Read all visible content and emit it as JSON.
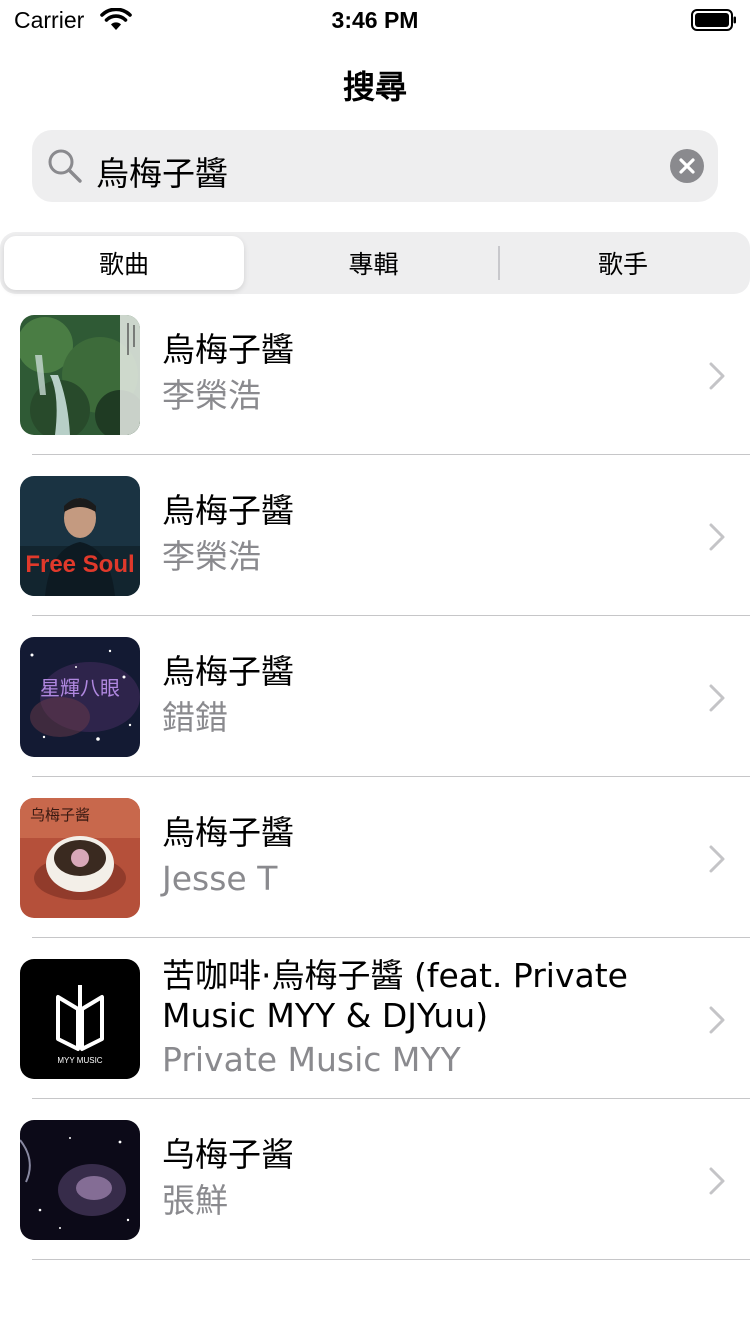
{
  "status_bar": {
    "carrier": "Carrier",
    "time": "3:46 PM"
  },
  "nav": {
    "title": "搜尋"
  },
  "search": {
    "query": "烏梅子醬"
  },
  "segments": [
    {
      "label": "歌曲",
      "selected": true
    },
    {
      "label": "專輯",
      "selected": false
    },
    {
      "label": "歌手",
      "selected": false
    }
  ],
  "results": [
    {
      "title": "烏梅子醬",
      "title_line2": "",
      "artist": "李榮浩",
      "artwork_text": ""
    },
    {
      "title": "烏梅子醬",
      "title_line2": "",
      "artist": "李榮浩",
      "artwork_text": "Free Soul"
    },
    {
      "title": "烏梅子醬",
      "title_line2": "",
      "artist": "錯錯",
      "artwork_text": "星輝八眼"
    },
    {
      "title": "烏梅子醬",
      "title_line2": "",
      "artist": "Jesse T",
      "artwork_text": "乌梅子酱"
    },
    {
      "title": "苦咖啡·烏梅子醬 (feat. Private",
      "title_line2": "Music MYY & DJYuu)",
      "artist": "Private Music MYY",
      "artwork_text": "MYY MUSIC"
    },
    {
      "title": "乌梅子酱",
      "title_line2": "",
      "artist": "張鮮",
      "artwork_text": ""
    }
  ],
  "colors": {
    "secondary_text": "#8a8a8e",
    "search_bg": "#eeeeef",
    "separator": "#c6c6c8"
  }
}
